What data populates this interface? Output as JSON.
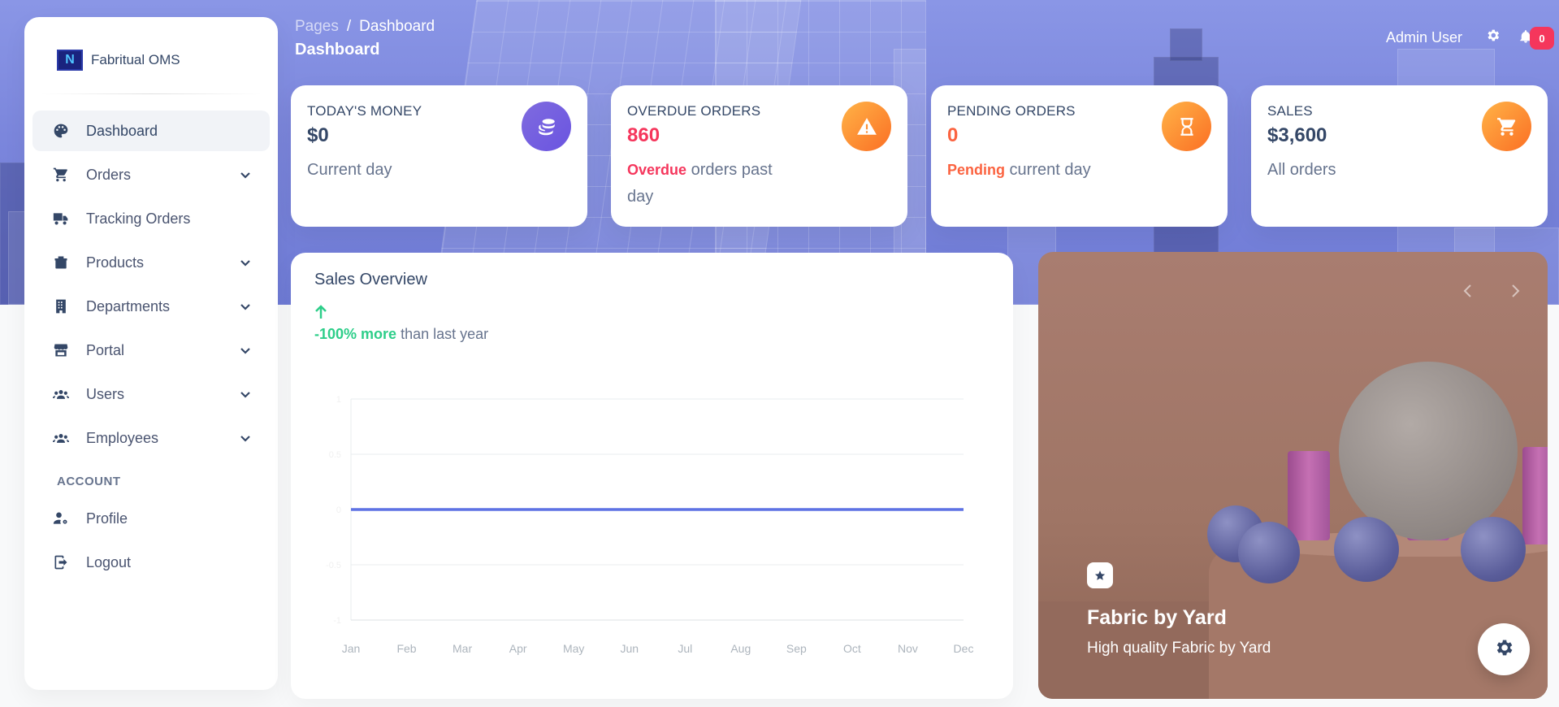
{
  "brand": {
    "name": "Fabritual OMS",
    "logo_letter": "N"
  },
  "breadcrumb": {
    "root": "Pages",
    "separator": "/",
    "current": "Dashboard"
  },
  "page_title": "Dashboard",
  "topbar": {
    "user_label": "Admin User",
    "notification_count": "0"
  },
  "sidebar": {
    "items": [
      {
        "label": "Dashboard",
        "icon": "palette-icon",
        "active": true,
        "has_submenu": false
      },
      {
        "label": "Orders",
        "icon": "cart-icon",
        "has_submenu": true
      },
      {
        "label": "Tracking Orders",
        "icon": "truck-icon",
        "has_submenu": false
      },
      {
        "label": "Products",
        "icon": "box-icon",
        "has_submenu": true
      },
      {
        "label": "Departments",
        "icon": "building-icon",
        "has_submenu": true
      },
      {
        "label": "Portal",
        "icon": "store-icon",
        "has_submenu": true
      },
      {
        "label": "Users",
        "icon": "users-icon",
        "has_submenu": true
      },
      {
        "label": "Employees",
        "icon": "users-icon",
        "has_submenu": true
      }
    ],
    "account_section_label": "ACCOUNT",
    "account_items": [
      {
        "label": "Profile",
        "icon": "user-cog-icon"
      },
      {
        "label": "Logout",
        "icon": "logout-icon"
      }
    ]
  },
  "stats": [
    {
      "label": "TODAY'S MONEY",
      "value": "$0",
      "sub_highlight": "",
      "sub_text": "Current day",
      "icon": "coins-icon",
      "color": "#7b61e0"
    },
    {
      "label": "OVERDUE ORDERS",
      "value": "860",
      "sub_highlight": "Overdue",
      "sub_text": " orders past day",
      "icon": "warning-icon",
      "color": "#f5365c"
    },
    {
      "label": "PENDING ORDERS",
      "value": "0",
      "sub_highlight": "Pending",
      "sub_text": " current day",
      "icon": "hourglass-icon",
      "color": "#fb6340"
    },
    {
      "label": "SALES",
      "value": "$3,600",
      "sub_highlight": "",
      "sub_text": "All orders",
      "icon": "cart-icon",
      "color": "#344767"
    }
  ],
  "sales_overview": {
    "title": "Sales Overview",
    "delta_value": "-100% more",
    "delta_text": " than last year"
  },
  "chart_data": {
    "type": "line",
    "title": "Sales Overview",
    "categories": [
      "Jan",
      "Feb",
      "Mar",
      "Apr",
      "May",
      "Jun",
      "Jul",
      "Aug",
      "Sep",
      "Oct",
      "Nov",
      "Dec"
    ],
    "series": [
      {
        "values": [
          0,
          0,
          0,
          0,
          0,
          0,
          0,
          0,
          0,
          0,
          0,
          0
        ],
        "color": "#5e72e4"
      }
    ],
    "yticks": [
      "1",
      "0.5",
      "0",
      "-0.5",
      "-1"
    ],
    "ylim": [
      -1,
      1
    ],
    "grid": true
  },
  "promo": {
    "title": "Fabric by Yard",
    "subtitle": "High quality Fabric by Yard"
  }
}
